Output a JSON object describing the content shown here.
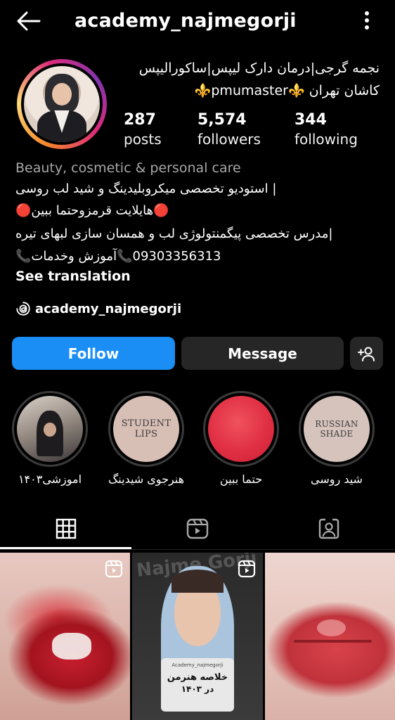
{
  "header": {
    "username": "academy_najmegorji"
  },
  "profile": {
    "name_line": "نجمه گرجی|درمان دارک لیپس|ساکورالیپس",
    "location_line": "کاشان تهران ⚜️pmumaster⚜️",
    "stats": [
      {
        "value": "287",
        "label": "posts"
      },
      {
        "value": "5,574",
        "label": "followers"
      },
      {
        "value": "344",
        "label": "following"
      }
    ],
    "category": "Beauty, cosmetic & personal care",
    "bio_lines": [
      "| استودیو تخصصی میکروبلیدینگ و شید لب روسی",
      "🔴هایلایت قرمزوحتما ببین🔴",
      "|مدرس تخصصی پیگمنتولوژی لب و همسان سازی لبهای تیره",
      "09303356313📞آموزش وخدمات📞"
    ],
    "see_translation": "See translation",
    "threads_handle": "academy_najmegorji"
  },
  "actions": {
    "follow": "Follow",
    "message": "Message"
  },
  "highlights": [
    {
      "label": "اموزشی۱۴۰۳",
      "cover_text": ""
    },
    {
      "label": "هنرجوی شیدینگ",
      "cover_text": "STUDENT LIPS"
    },
    {
      "label": "حتما ببین",
      "cover_text": ""
    },
    {
      "label": "شید روسی",
      "cover_text": "RUSSIAN SHADE"
    }
  ],
  "posts": [
    {
      "type": "reel"
    },
    {
      "type": "reel",
      "watermark": "Najme Gorji",
      "card_account": "Academy_najmegorji",
      "card_title": "خلاصه هنرمن",
      "card_subtitle": "در ۱۴۰۳"
    },
    {
      "type": "image"
    }
  ],
  "colors": {
    "follow": "#1a8ef5",
    "secondary_button": "#262626",
    "muted_text": "#a8a8a8"
  }
}
